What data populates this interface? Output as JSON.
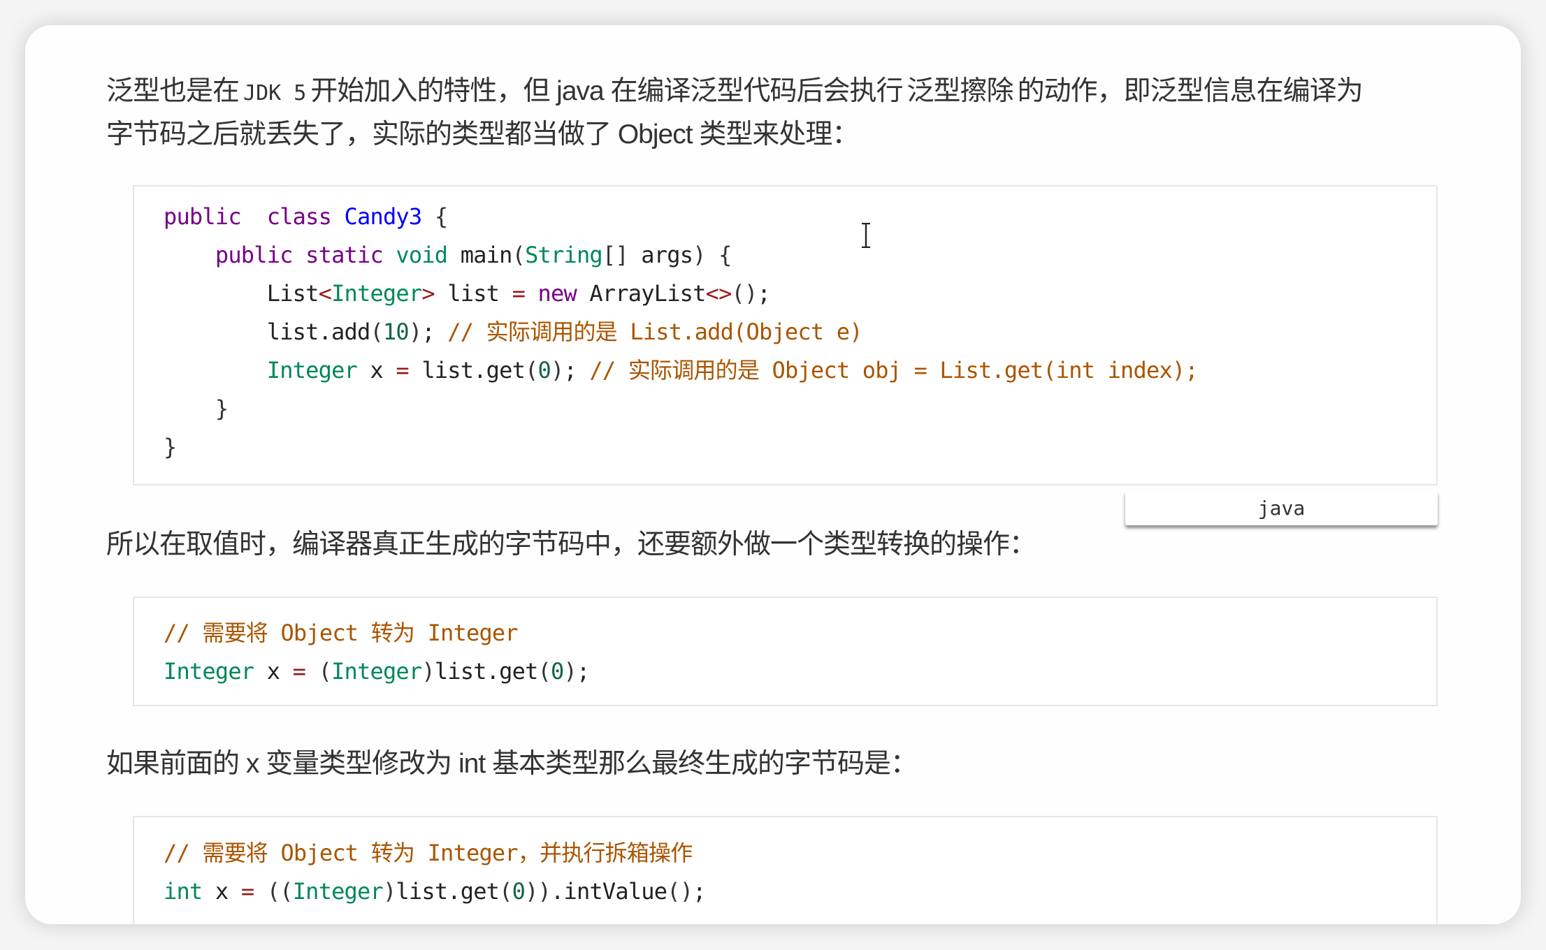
{
  "paragraphs": {
    "p1_line1": {
      "before": "泛型也是在",
      "code1": "JDK 5",
      "mid": "开始加入的特性，但 java 在编译泛型代码后会执行",
      "highlight": "泛型擦除",
      "after": "的动作，即泛型信息在编译为"
    },
    "p1_line2": "字节码之后就丢失了，实际的类型都当做了 Object 类型来处理：",
    "p2": "所以在取值时，编译器真正生成的字节码中，还要额外做一个类型转换的操作：",
    "p3": "如果前面的 x 变量类型修改为 int 基本类型那么最终生成的字节码是："
  },
  "code_block_1": {
    "language": "java",
    "lines": [
      [
        [
          "kw",
          "public"
        ],
        [
          "",
          "  "
        ],
        [
          "kw",
          "class"
        ],
        [
          "",
          " "
        ],
        [
          "def",
          "Candy3"
        ],
        [
          "",
          " "
        ],
        [
          "br",
          "{"
        ]
      ],
      [
        [
          "",
          "    "
        ],
        [
          "kw",
          "public"
        ],
        [
          "",
          " "
        ],
        [
          "kw",
          "static"
        ],
        [
          "",
          " "
        ],
        [
          "ty",
          "void"
        ],
        [
          "",
          " main"
        ],
        [
          "br",
          "("
        ],
        [
          "ty",
          "String"
        ],
        [
          "br",
          "[]"
        ],
        [
          "",
          " args"
        ],
        [
          "br",
          ")"
        ],
        [
          "",
          " "
        ],
        [
          "br",
          "{"
        ]
      ],
      [
        [
          "",
          "        List"
        ],
        [
          "op",
          "<"
        ],
        [
          "ty",
          "Integer"
        ],
        [
          "op",
          ">"
        ],
        [
          "",
          " list "
        ],
        [
          "op",
          "="
        ],
        [
          "",
          " "
        ],
        [
          "kw",
          "new"
        ],
        [
          "",
          " ArrayList"
        ],
        [
          "op",
          "<>"
        ],
        [
          "br",
          "()"
        ],
        [
          "",
          ";"
        ]
      ],
      [
        [
          "",
          "        list.add"
        ],
        [
          "br",
          "("
        ],
        [
          "num",
          "10"
        ],
        [
          "br",
          ")"
        ],
        [
          "",
          ";"
        ],
        [
          "",
          " "
        ],
        [
          "cm",
          "// 实际调用的是 List.add(Object e)"
        ]
      ],
      [
        [
          "",
          "        "
        ],
        [
          "ty",
          "Integer"
        ],
        [
          "",
          " x "
        ],
        [
          "op",
          "="
        ],
        [
          "",
          " list.get"
        ],
        [
          "br",
          "("
        ],
        [
          "num",
          "0"
        ],
        [
          "br",
          ")"
        ],
        [
          "",
          ";"
        ],
        [
          "",
          " "
        ],
        [
          "cm",
          "// 实际调用的是 Object obj = List.get(int index);"
        ]
      ],
      [
        [
          "",
          "    "
        ],
        [
          "br",
          "}"
        ]
      ],
      [
        [
          "br",
          "}"
        ]
      ]
    ]
  },
  "code_block_2": {
    "lines": [
      [
        [
          "cm",
          "// 需要将 Object 转为 Integer"
        ]
      ],
      [
        [
          "ty",
          "Integer"
        ],
        [
          "",
          " x "
        ],
        [
          "op",
          "="
        ],
        [
          "",
          " "
        ],
        [
          "br",
          "("
        ],
        [
          "ty",
          "Integer"
        ],
        [
          "br",
          ")"
        ],
        [
          "",
          "list.get"
        ],
        [
          "br",
          "("
        ],
        [
          "num",
          "0"
        ],
        [
          "br",
          ")"
        ],
        [
          "",
          ";"
        ]
      ]
    ]
  },
  "code_block_3": {
    "lines": [
      [
        [
          "cm",
          "// 需要将 Object 转为 Integer，并执行拆箱操作"
        ]
      ],
      [
        [
          "ty",
          "int"
        ],
        [
          "",
          " x "
        ],
        [
          "op",
          "="
        ],
        [
          "",
          " "
        ],
        [
          "br",
          "(("
        ],
        [
          "ty",
          "Integer"
        ],
        [
          "br",
          ")"
        ],
        [
          "",
          "list.get"
        ],
        [
          "br",
          "("
        ],
        [
          "num",
          "0"
        ],
        [
          "br",
          "))"
        ],
        [
          "",
          ".intValue"
        ],
        [
          "br",
          "()"
        ],
        [
          "",
          ";"
        ]
      ]
    ]
  },
  "language_badge": "java",
  "cursor": "text-cursor",
  "colors": {
    "keyword": "#770088",
    "type": "#008855",
    "definition": "#0000ff",
    "number": "#116644",
    "operator": "#981a1a",
    "comment": "#aa5500",
    "text": "#333333"
  }
}
